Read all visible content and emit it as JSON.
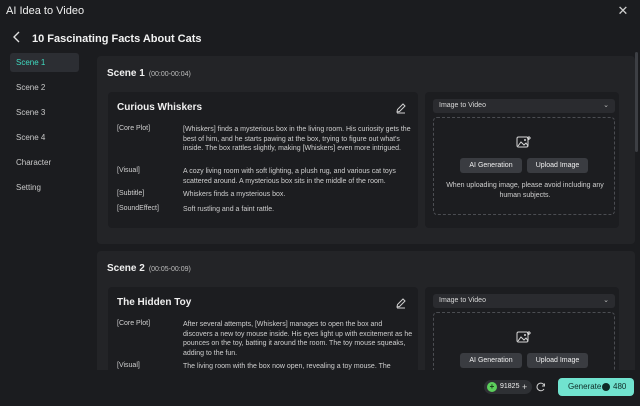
{
  "window": {
    "title": "AI Idea to Video",
    "close_label": "✕"
  },
  "header": {
    "title": "10 Fascinating Facts About Cats"
  },
  "sidebar": {
    "items": [
      {
        "label": "Scene 1"
      },
      {
        "label": "Scene 2"
      },
      {
        "label": "Scene 3"
      },
      {
        "label": "Scene 4"
      },
      {
        "label": "Character"
      },
      {
        "label": "Setting"
      }
    ],
    "active": "Scene 1"
  },
  "scenes": [
    {
      "heading": "Scene 1",
      "time": "(00:00-00:04)",
      "title": "Curious Whiskers",
      "fields": [
        {
          "label": "[Core Plot]",
          "text": "[Whiskers] finds a mysterious box in the living room. His curiosity gets the best of him, and he starts pawing at the box, trying to figure out what's inside. The box rattles slightly, making [Whiskers] even more intrigued."
        },
        {
          "label": "[Visual]",
          "text": "A cozy living room with soft lighting, a plush rug, and various cat toys scattered around. A mysterious box sits in the middle of the room."
        },
        {
          "label": "[Subtitle]",
          "text": "Whiskers finds a mysterious box."
        },
        {
          "label": "[SoundEffect]",
          "text": "Soft rustling and a faint rattle."
        }
      ],
      "media": {
        "mode": "Image to Video",
        "ai_button": "AI Generation",
        "upload_button": "Upload Image",
        "hint": "When uploading image, please avoid including any human subjects."
      }
    },
    {
      "heading": "Scene 2",
      "time": "(00:05-00:09)",
      "title": "The Hidden Toy",
      "fields": [
        {
          "label": "[Core Plot]",
          "text": "After several attempts, [Whiskers] manages to open the box and discovers a new toy mouse inside. His eyes light up with excitement as he pounces on the toy, batting it around the room. The toy mouse squeaks, adding to the fun."
        },
        {
          "label": "[Visual]",
          "text": "The living room with the box now open, revealing a toy mouse. The"
        }
      ],
      "media": {
        "mode": "Image to Video",
        "ai_button": "AI Generation",
        "upload_button": "Upload Image"
      }
    }
  ],
  "footer": {
    "credits": "91825",
    "credits_plus": "+",
    "generate_label": "Generate",
    "generate_cost": "480"
  },
  "colors": {
    "accent": "#71e3cf",
    "active_text": "#3fdcc2",
    "credit_green": "#5ccf5c"
  }
}
